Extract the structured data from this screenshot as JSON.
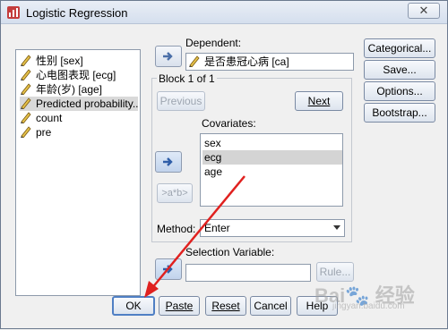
{
  "window": {
    "title": "Logistic Regression",
    "close_glyph": "✕"
  },
  "variables": [
    {
      "label": "性别 [sex]",
      "icon": "ruler-pencil-icon",
      "selected": false
    },
    {
      "label": "心电图表现 [ecg]",
      "icon": "ruler-pencil-icon",
      "selected": false
    },
    {
      "label": "年龄(岁) [age]",
      "icon": "ruler-pencil-icon",
      "selected": false
    },
    {
      "label": "Predicted probability...",
      "icon": "ruler-pencil-icon",
      "selected": true
    },
    {
      "label": "count",
      "icon": "ruler-pencil-icon",
      "selected": false
    },
    {
      "label": "pre",
      "icon": "ruler-pencil-icon",
      "selected": false
    }
  ],
  "dependent": {
    "label": "Dependent:",
    "value": "是否患冠心病 [ca]"
  },
  "block": {
    "label": "Block 1 of 1",
    "previous": "Previous",
    "next": "Next"
  },
  "covariates": {
    "label": "Covariates:",
    "items": [
      {
        "label": "sex",
        "selected": false
      },
      {
        "label": "ecg",
        "selected": true
      },
      {
        "label": "age",
        "selected": false
      }
    ],
    "interaction_button": ">a*b>"
  },
  "method": {
    "label": "Method:",
    "value": "Enter"
  },
  "selection_variable": {
    "label": "Selection Variable:",
    "value": "",
    "rule_button": "Rule..."
  },
  "side_buttons": [
    "Categorical...",
    "Save...",
    "Options...",
    "Bootstrap..."
  ],
  "bottom_buttons": [
    "OK",
    "Paste",
    "Reset",
    "Cancel",
    "Help"
  ],
  "watermark": {
    "text": "Bai🐾 经验",
    "sub": "jingyan.baidu.com"
  },
  "colors": {
    "annotation_arrow": "#e0211f",
    "selection_gray": "#d9d9d9"
  }
}
